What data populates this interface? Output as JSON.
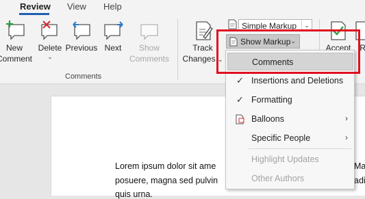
{
  "tabs": [
    {
      "label": "Review",
      "active": true
    },
    {
      "label": "View",
      "active": false
    },
    {
      "label": "Help",
      "active": false
    }
  ],
  "ribbon": {
    "comments_group": {
      "label": "Comments",
      "new_comment": {
        "line1": "New",
        "line2": "Comment"
      },
      "delete": {
        "line1": "Delete"
      },
      "previous": {
        "line1": "Previous"
      },
      "next": {
        "line1": "Next"
      },
      "show_comments": {
        "line1": "Show",
        "line2": "Comments"
      }
    },
    "tracking_group": {
      "track_changes": {
        "line1": "Track",
        "line2": "Changes"
      },
      "display_combo": {
        "value": "Simple Markup"
      },
      "show_markup": {
        "label": "Show Markup"
      }
    },
    "changes_group": {
      "accept_partial": "Accept",
      "reject_partial": "Re"
    }
  },
  "menu": {
    "items": [
      {
        "label": "Comments",
        "checked": false,
        "submenu": false,
        "enabled": true,
        "highlighted": true
      },
      {
        "label": "Insertions and Deletions",
        "checked": true,
        "submenu": false,
        "enabled": true
      },
      {
        "label": "Formatting",
        "checked": true,
        "submenu": false,
        "enabled": true
      },
      {
        "label": "Balloons",
        "checked": false,
        "submenu": true,
        "enabled": true
      },
      {
        "label": "Specific People",
        "checked": false,
        "submenu": true,
        "enabled": true
      },
      {
        "label": "Highlight Updates",
        "checked": false,
        "submenu": false,
        "enabled": false
      },
      {
        "label": "Other Authors",
        "checked": false,
        "submenu": false,
        "enabled": false
      }
    ]
  },
  "document": {
    "lines": [
      "Lorem ipsum dolor sit ame",
      "posuere, magna sed pulvin",
      "quis urna."
    ],
    "right_fragments": [
      "Mae",
      "adi"
    ]
  },
  "colors": {
    "accent": "#1f5fb0",
    "highlight_box": "#e01020",
    "icon_green": "#2e9a3e",
    "icon_red": "#d8262e",
    "icon_blue": "#2b79c7"
  }
}
